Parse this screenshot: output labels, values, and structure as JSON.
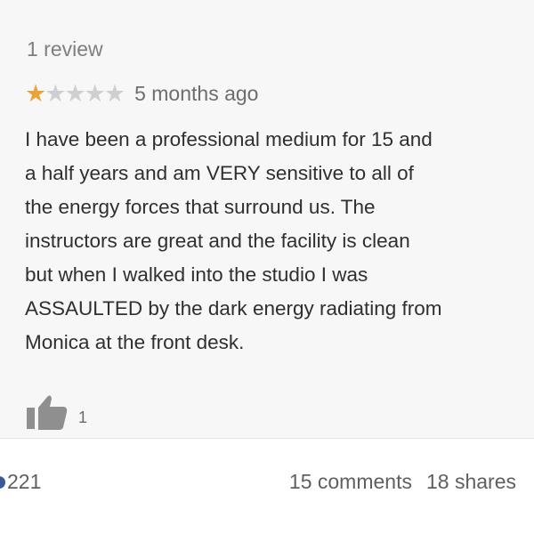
{
  "review": {
    "cutoff_name": "",
    "review_count": "1 review",
    "rating": {
      "value": 1,
      "max": 5,
      "filled_color": "#e8a33a",
      "empty_color": "#cfcfcf"
    },
    "date": "5 months ago",
    "body_lines": [
      "I have been a professional medium for 15 and",
      "a half years and am VERY sensitive to all of",
      "the energy forces that surround us. The",
      "instructors are great and the facility is clean",
      "but when I walked into the studio I was",
      "ASSAULTED by the dark energy radiating from",
      "Monica at the front desk."
    ],
    "helpful": {
      "icon": "thumbs-up-icon",
      "count": "1"
    }
  },
  "post_footer": {
    "reactions_count": "221",
    "comments": "15 comments",
    "shares": "18 shares"
  }
}
